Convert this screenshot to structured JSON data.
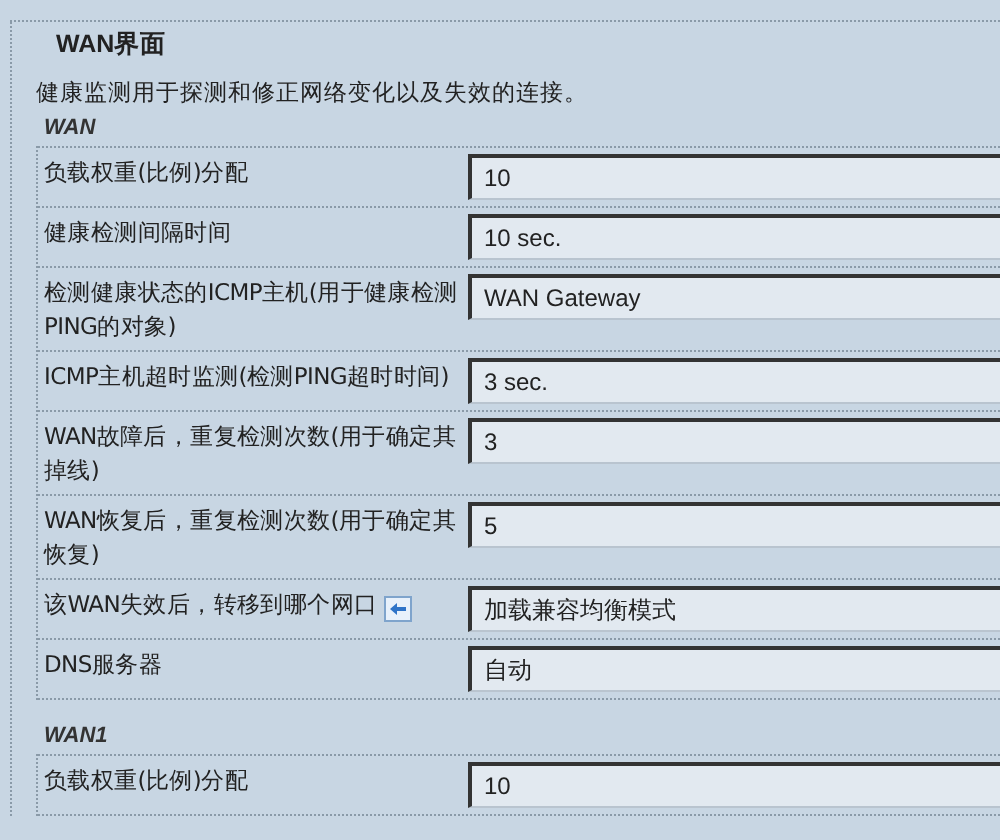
{
  "panel": {
    "legend": "WAN界面",
    "description": "健康监测用于探测和修正网络变化以及失效的连接。"
  },
  "sections": [
    {
      "title": "WAN",
      "rows": [
        {
          "label": "负载权重(比例)分配",
          "value": "10",
          "help_icon": false
        },
        {
          "label": "健康检测间隔时间",
          "value": "10 sec.",
          "help_icon": false
        },
        {
          "label": "检测健康状态的ICMP主机(用于健康检测PING的对象)",
          "value": "WAN Gateway",
          "help_icon": false
        },
        {
          "label": "ICMP主机超时监测(检测PING超时时间)",
          "value": "3 sec.",
          "help_icon": false
        },
        {
          "label": "WAN故障后，重复检测次数(用于确定其掉线)",
          "value": "3",
          "help_icon": false
        },
        {
          "label": "WAN恢复后，重复检测次数(用于确定其恢复)",
          "value": "5",
          "help_icon": false
        },
        {
          "label": "该WAN失效后，转移到哪个网口",
          "value": "加载兼容均衡模式",
          "help_icon": true
        },
        {
          "label": "DNS服务器",
          "value": "自动",
          "help_icon": false
        }
      ]
    },
    {
      "title": "WAN1",
      "rows": [
        {
          "label": "负载权重(比例)分配",
          "value": "10",
          "help_icon": false
        }
      ]
    }
  ]
}
